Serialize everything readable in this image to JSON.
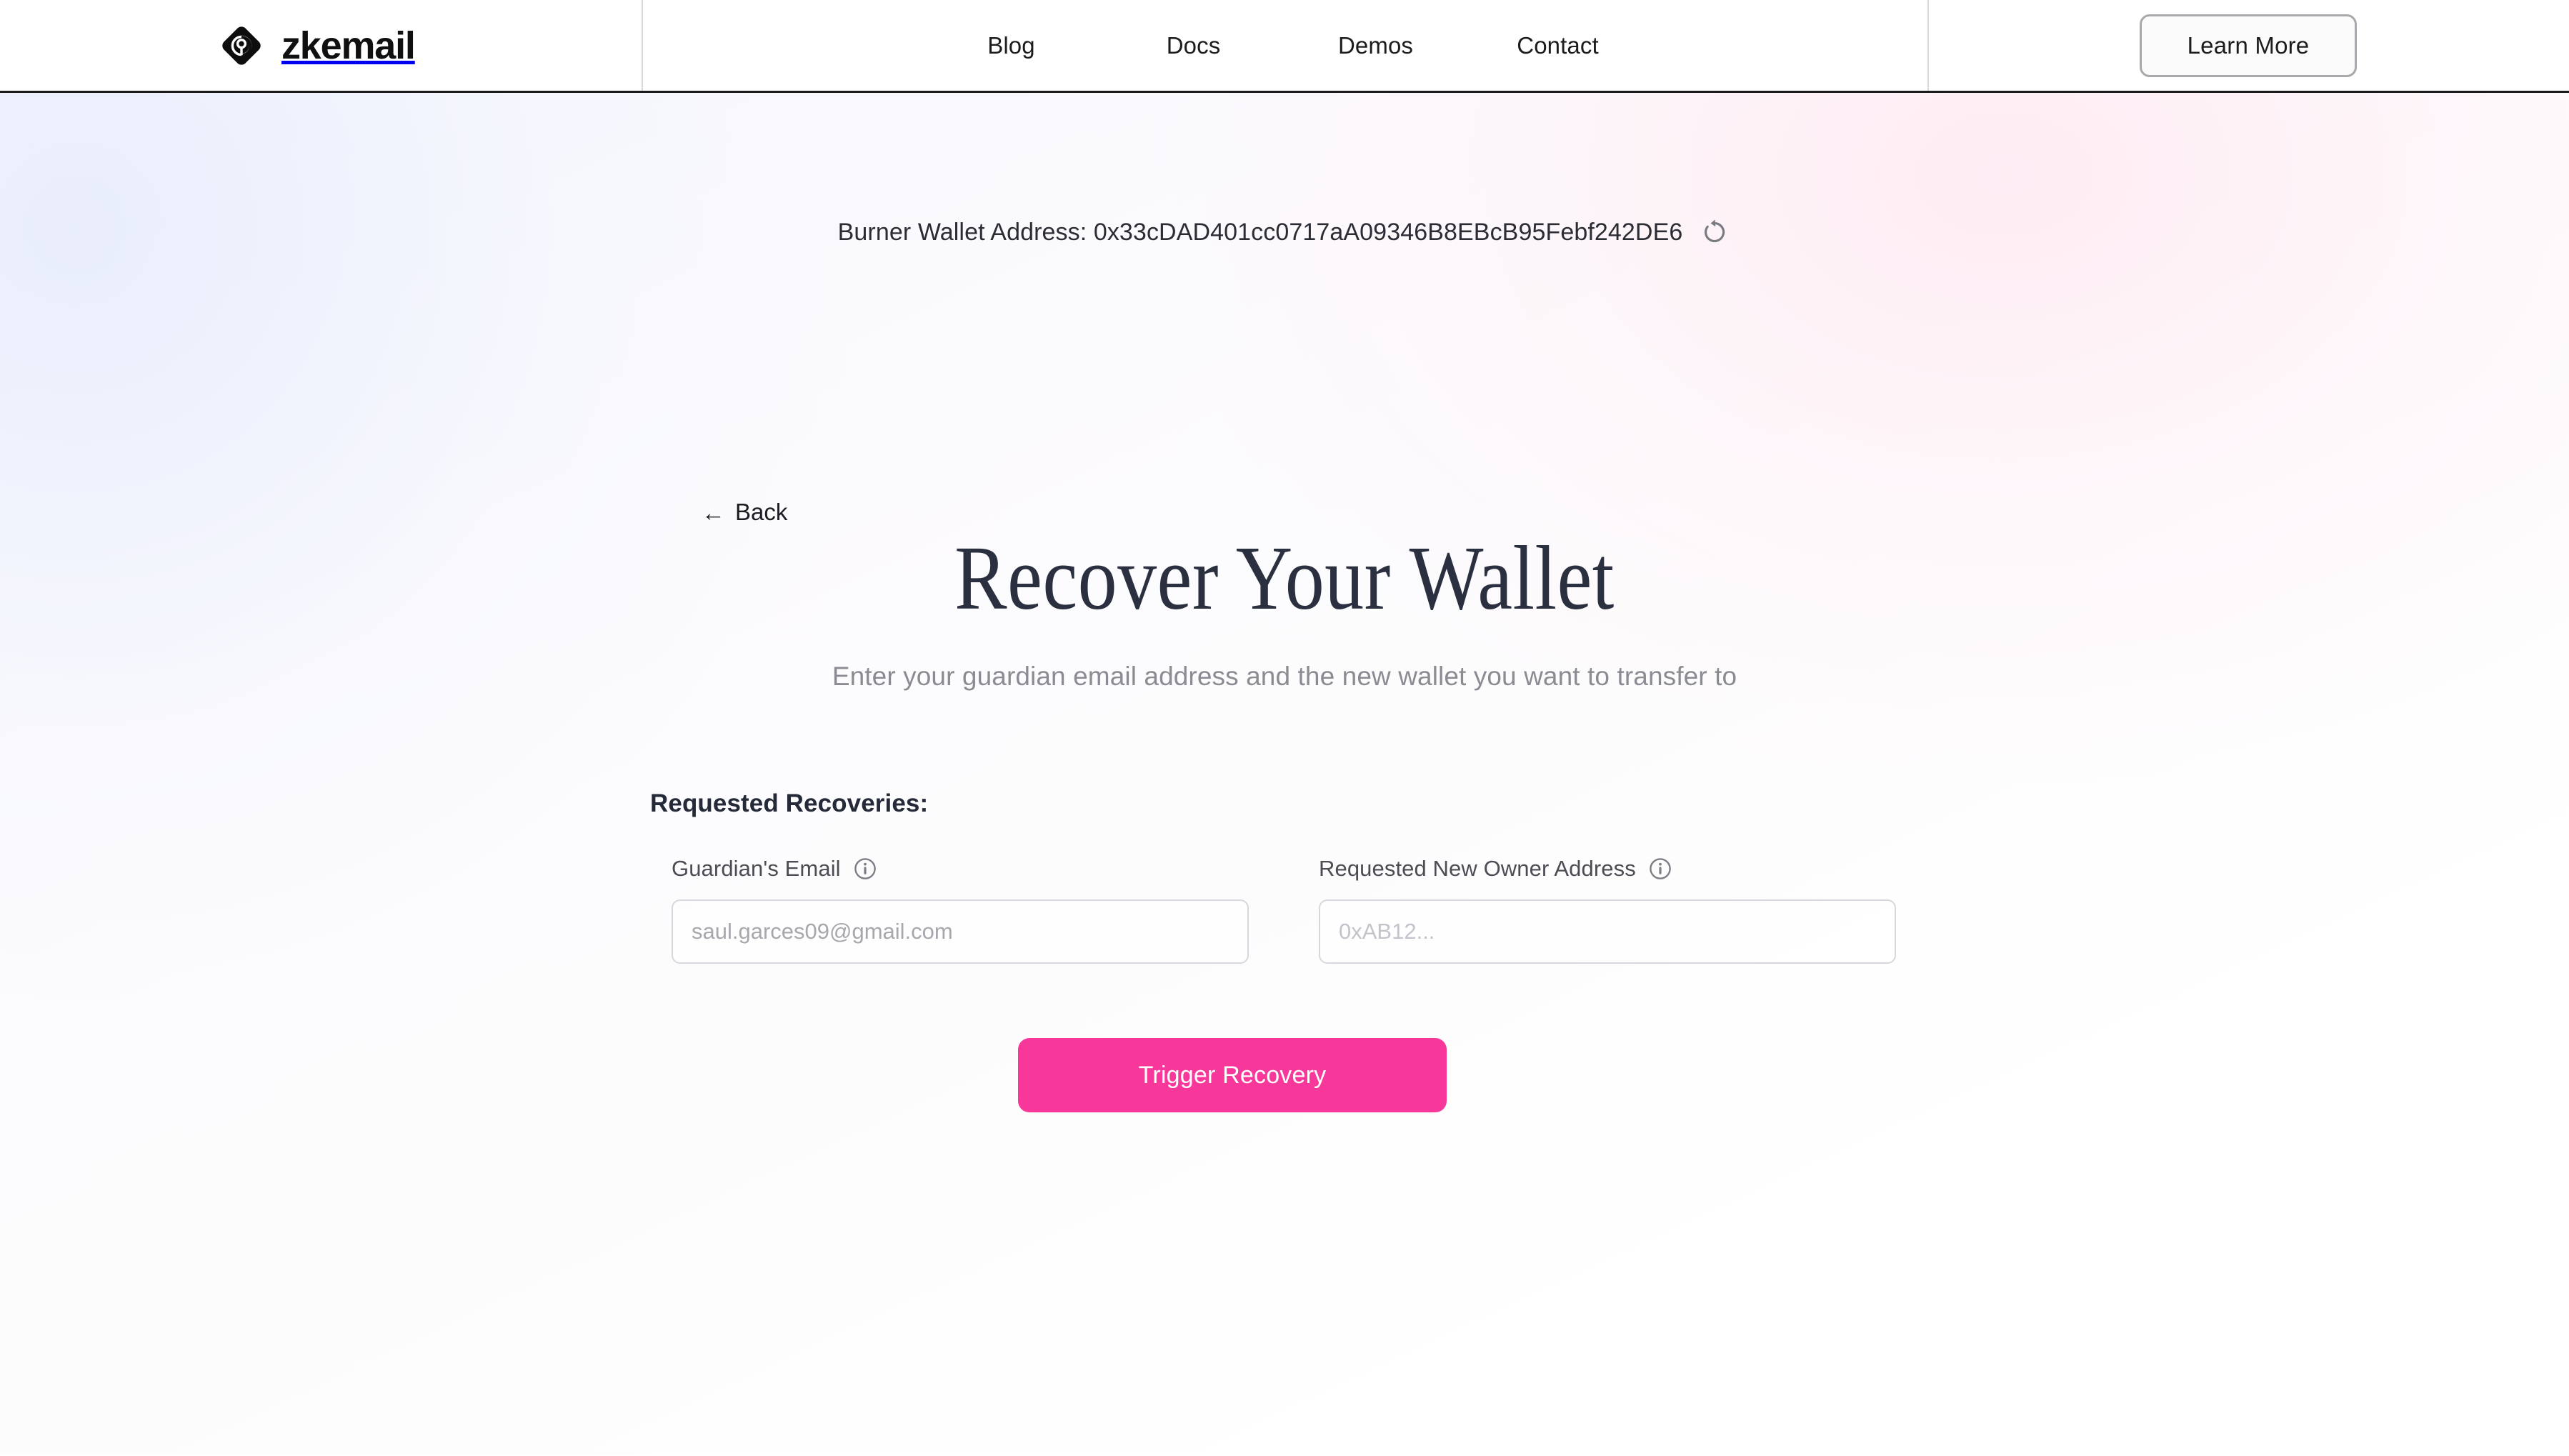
{
  "brand": {
    "name": "zkemail",
    "logo_icon": "zkemail-diamond-logo"
  },
  "nav": {
    "links": [
      {
        "label": "Blog"
      },
      {
        "label": "Docs"
      },
      {
        "label": "Demos"
      },
      {
        "label": "Contact"
      }
    ],
    "cta_label": "Learn More"
  },
  "burner": {
    "label_and_address": "Burner Wallet Address: 0x33cDAD401cc0717aA09346B8EBcB95Febf242DE6",
    "address": "0x33cDAD401cc0717aA09346B8EBcB95Febf242DE6",
    "refresh_icon": "refresh-icon"
  },
  "back": {
    "arrow": "←",
    "label": "Back"
  },
  "hero": {
    "title": "Recover Your Wallet",
    "subtitle": "Enter your guardian email address and the new wallet you want to transfer to"
  },
  "form": {
    "heading": "Requested Recoveries:",
    "guardian": {
      "label": "Guardian's Email",
      "info_icon": "info-icon",
      "value": "",
      "placeholder": "saul.garces09@gmail.com"
    },
    "new_owner": {
      "label": "Requested New Owner Address",
      "info_icon": "info-icon",
      "value": "",
      "placeholder": "0xAB12..."
    },
    "submit_label": "Trigger Recovery"
  },
  "colors": {
    "accent_pink": "#F8379B",
    "heading_navy": "#2B3040",
    "nav_text": "#1C1C1C",
    "muted_text": "#8B8B93",
    "input_border": "#D7D7DD"
  }
}
